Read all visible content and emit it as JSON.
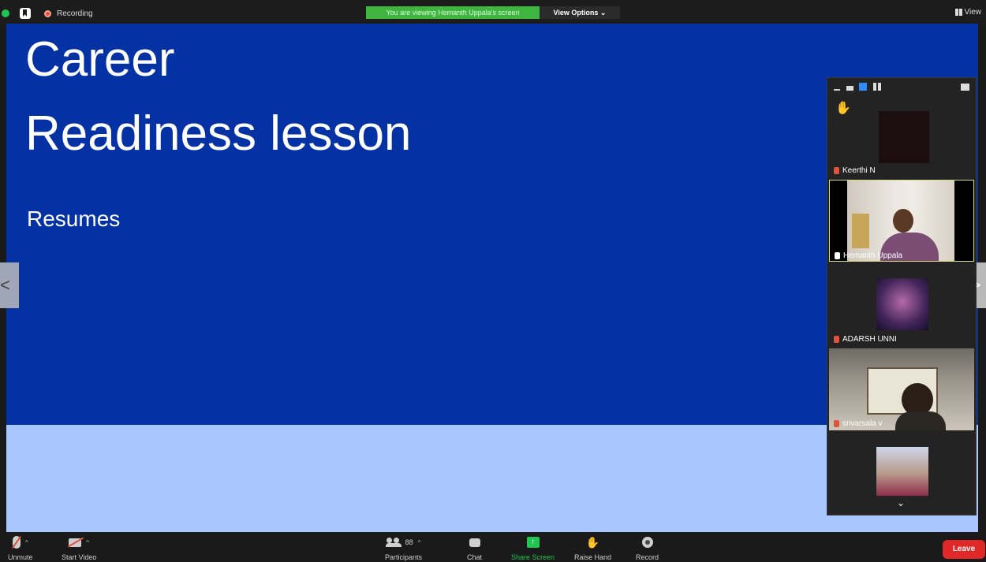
{
  "topbar": {
    "recording_label": "Recording",
    "viewing_banner": "You are viewing Hemanth Uppala's screen",
    "view_options_label": "View Options",
    "view_label": "View"
  },
  "slide": {
    "title_line1": "Career",
    "title_line2": "Readiness lesson",
    "subtitle": "Resumes",
    "background_color": "#0432a5",
    "footer_color": "#a8c6ff"
  },
  "nav": {
    "prev_glyph": "<",
    "next_glyph": ">"
  },
  "participants_panel": {
    "tiles": [
      {
        "name": "Keerthi N",
        "muted": true
      },
      {
        "name": "Hemanth Uppala",
        "pinned": true,
        "active_speaker": true
      },
      {
        "name": "ADARSH UNNI",
        "muted": true
      },
      {
        "name": "srivarsala v",
        "muted": true
      },
      {
        "name": "",
        "muted": true
      }
    ]
  },
  "toolbar": {
    "unmute_label": "Unmute",
    "start_video_label": "Start Video",
    "participants_label": "Participants",
    "participants_count": "88",
    "chat_label": "Chat",
    "share_screen_label": "Share Screen",
    "raise_hand_label": "Raise Hand",
    "record_label": "Record",
    "leave_label": "Leave"
  },
  "colors": {
    "share_green": "#23c552",
    "leave_red": "#e02828",
    "banner_green": "#3fb540"
  }
}
